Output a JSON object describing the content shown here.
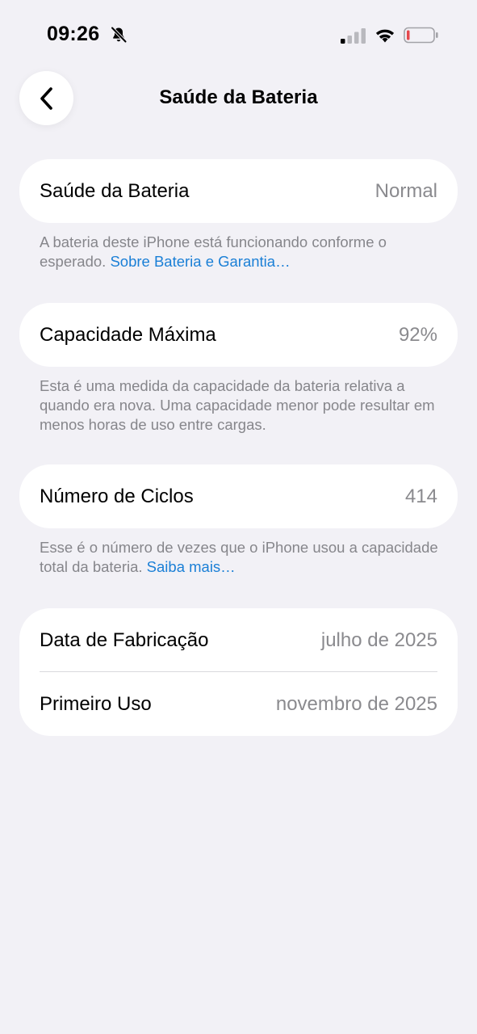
{
  "status_bar": {
    "time": "09:26"
  },
  "header": {
    "title": "Saúde da Bateria"
  },
  "battery_health": {
    "label": "Saúde da Bateria",
    "value": "Normal",
    "footnote_text": "A bateria deste iPhone está funcionando conforme o esperado. ",
    "footnote_link": "Sobre Bateria e Garantia…"
  },
  "max_capacity": {
    "label": "Capacidade Máxima",
    "value": "92%",
    "footnote_text": "Esta é uma medida da capacidade da bateria relativa a quando era nova. Uma capacidade menor pode resultar em menos horas de uso entre cargas."
  },
  "cycle_count": {
    "label": "Número de Ciclos",
    "value": "414",
    "footnote_text": "Esse é o número de vezes que o iPhone usou a capacidade total da bateria. ",
    "footnote_link": "Saiba mais…"
  },
  "dates": {
    "manufacture_label": "Data de Fabricação",
    "manufacture_value": "julho de 2025",
    "first_use_label": "Primeiro Uso",
    "first_use_value": "novembro de 2025"
  },
  "colors": {
    "background": "#f2f1f6",
    "card": "#ffffff",
    "link": "#1a7fd6",
    "secondary_text": "#8a8a8e",
    "battery_low": "#e5484d"
  },
  "icons": {
    "back": "chevron-left-icon",
    "mute": "bell-slash-icon",
    "signal": "cellular-signal-icon",
    "wifi": "wifi-icon",
    "battery": "battery-icon"
  }
}
